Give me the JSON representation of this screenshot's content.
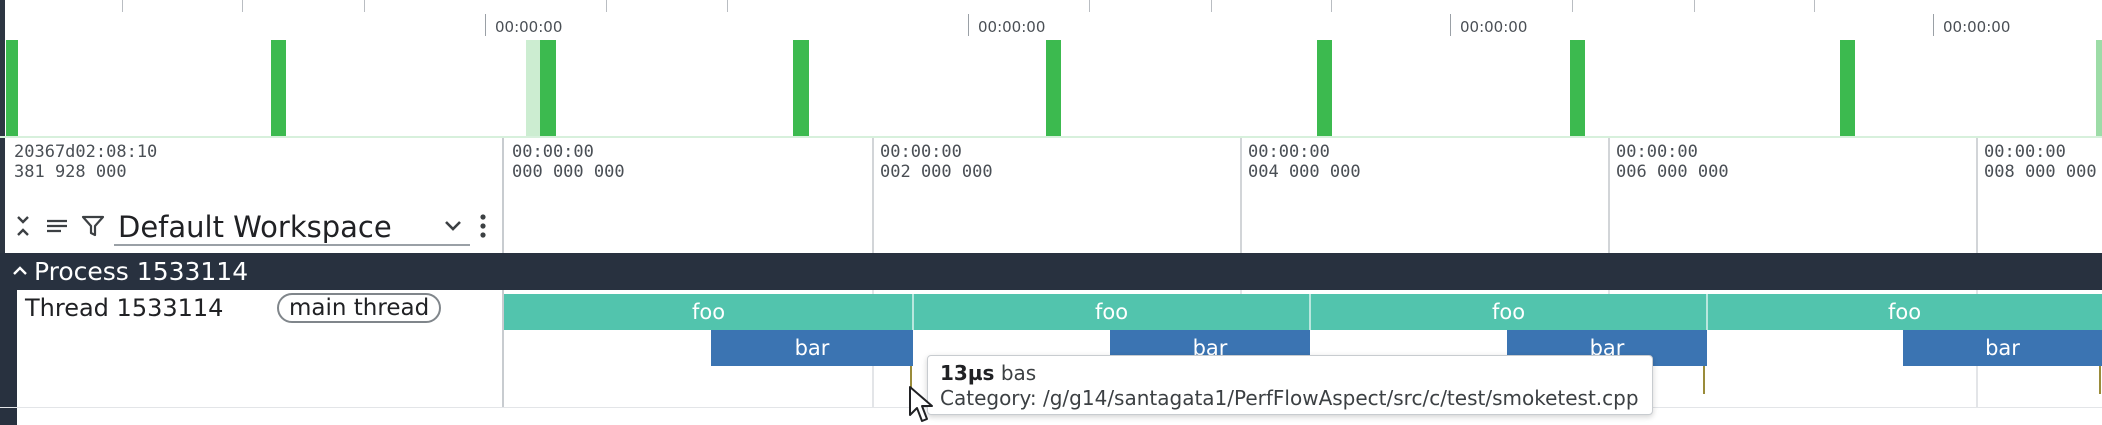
{
  "overview": {
    "time_labels": [
      "00:00:00",
      "00:00:00",
      "00:00:00",
      "00:00:00"
    ]
  },
  "header": {
    "info_line1": "20367d02:08:10",
    "info_line2": "381 928 000",
    "axis": [
      {
        "time": "00:00:00",
        "sub": "000 000 000"
      },
      {
        "time": "00:00:00",
        "sub": "002 000 000"
      },
      {
        "time": "00:00:00",
        "sub": "004 000 000"
      },
      {
        "time": "00:00:00",
        "sub": "006 000 000"
      },
      {
        "time": "00:00:00",
        "sub": "008 000 000"
      }
    ]
  },
  "toolbar": {
    "workspace": "Default Workspace",
    "icons": [
      "collapse-all-icon",
      "list-icon",
      "filter-icon",
      "chevron-down-icon",
      "more-vert-icon"
    ]
  },
  "process": {
    "title": "Process 1533114"
  },
  "thread": {
    "name": "Thread 1533114",
    "chip": "main thread",
    "slices": {
      "foo_label": "foo",
      "bar_label": "bar"
    }
  },
  "tooltip": {
    "duration": "13µs",
    "name": "bas",
    "category": "Category: /g/g14/santagata1/PerfFlowAspect/src/c/test/smoketest.cpp"
  },
  "colors": {
    "overview_green": "#3cba4f",
    "slice_foo": "#52c4ad",
    "slice_bar": "#3b74b2",
    "track_dark": "#28313f"
  }
}
